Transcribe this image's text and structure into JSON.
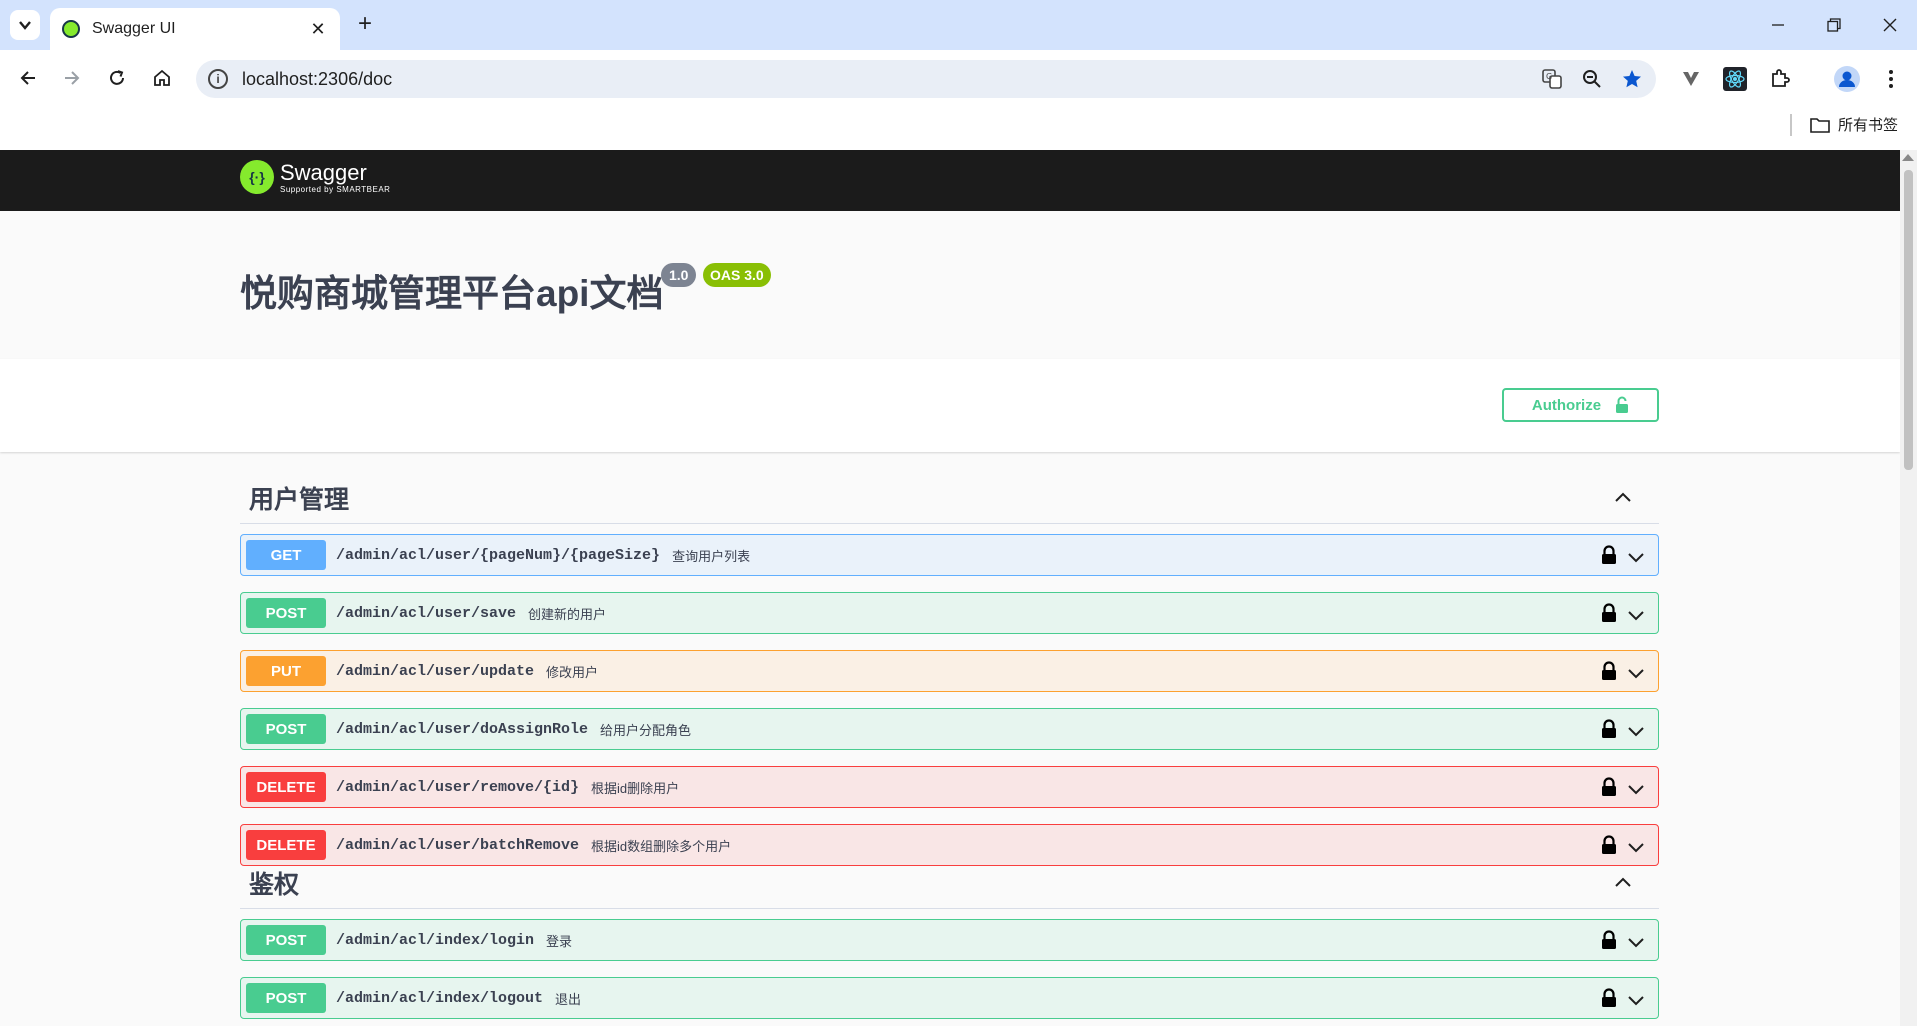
{
  "browser": {
    "tab_title": "Swagger UI",
    "url": "localhost:2306/doc",
    "bookmarks_label": "所有书签"
  },
  "swagger": {
    "logo_name": "Swagger",
    "logo_sub": "Supported by SMARTBEAR",
    "title": "悦购商城管理平台api文档",
    "version": "1.0",
    "oas": "OAS 3.0",
    "authorize_label": "Authorize"
  },
  "tags": [
    {
      "name": "用户管理",
      "operations": [
        {
          "method": "GET",
          "path": "/admin/acl/user/{pageNum}/{pageSize}",
          "summary": "查询用户列表"
        },
        {
          "method": "POST",
          "path": "/admin/acl/user/save",
          "summary": "创建新的用户"
        },
        {
          "method": "PUT",
          "path": "/admin/acl/user/update",
          "summary": "修改用户"
        },
        {
          "method": "POST",
          "path": "/admin/acl/user/doAssignRole",
          "summary": "给用户分配角色"
        },
        {
          "method": "DELETE",
          "path": "/admin/acl/user/remove/{id}",
          "summary": "根据id删除用户"
        },
        {
          "method": "DELETE",
          "path": "/admin/acl/user/batchRemove",
          "summary": "根据id数组删除多个用户"
        }
      ]
    },
    {
      "name": "鉴权",
      "operations": [
        {
          "method": "POST",
          "path": "/admin/acl/index/login",
          "summary": "登录"
        },
        {
          "method": "POST",
          "path": "/admin/acl/index/logout",
          "summary": "退出"
        }
      ]
    }
  ],
  "colors": {
    "get": "#61affe",
    "post": "#49cc90",
    "put": "#fca130",
    "delete": "#f93e3e"
  }
}
